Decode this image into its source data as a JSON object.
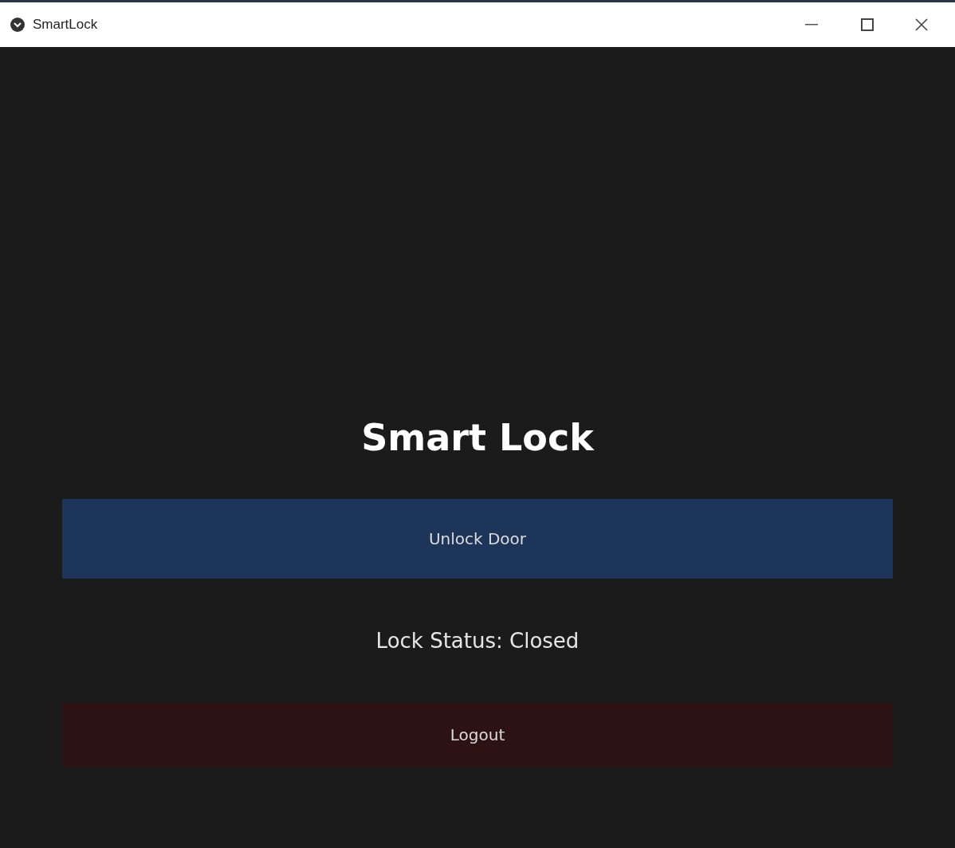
{
  "window": {
    "title": "SmartLock"
  },
  "heading": "Smart Lock",
  "buttons": [
    {
      "label": "Unlock Door",
      "kind": "primary"
    },
    {
      "label": "Logout",
      "kind": "danger"
    }
  ],
  "status": "Lock Status: Closed"
}
